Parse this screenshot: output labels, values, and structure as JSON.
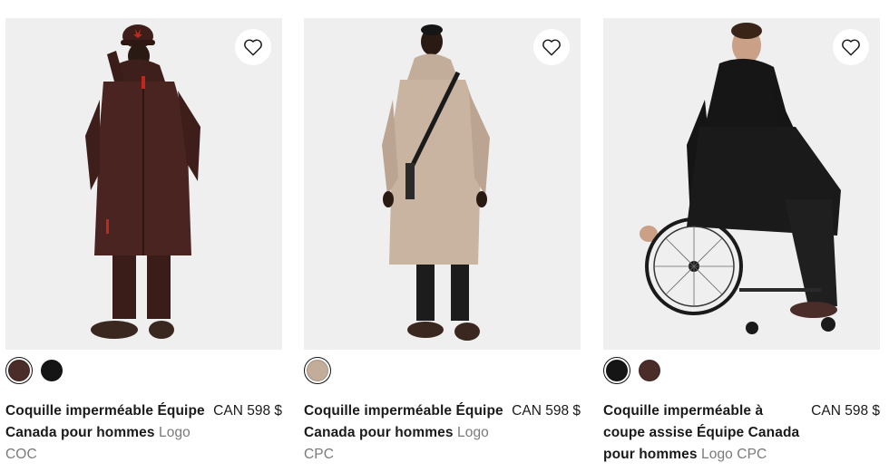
{
  "products": [
    {
      "name": "Coquille imperméable Équipe Canada pour hommes",
      "sub": "Logo COC",
      "price": "CAN 598 $",
      "swatches": [
        "#4a2c28",
        "#151515"
      ],
      "selected_swatch": 0
    },
    {
      "name": "Coquille imperméable Équipe Canada pour hommes",
      "sub": "Logo CPC",
      "price": "CAN 598 $",
      "swatches": [
        "#c2ad9b"
      ],
      "selected_swatch": 0
    },
    {
      "name": "Coquille imperméable à coupe assise Équipe Canada pour hommes",
      "sub": "Logo CPC",
      "price": "CAN 598 $",
      "swatches": [
        "#151515",
        "#4a2c28"
      ],
      "selected_swatch": 0
    }
  ],
  "colors": {
    "image_bg": "#efefef",
    "text": "#1a1a1a",
    "muted": "#7a7a7a"
  }
}
